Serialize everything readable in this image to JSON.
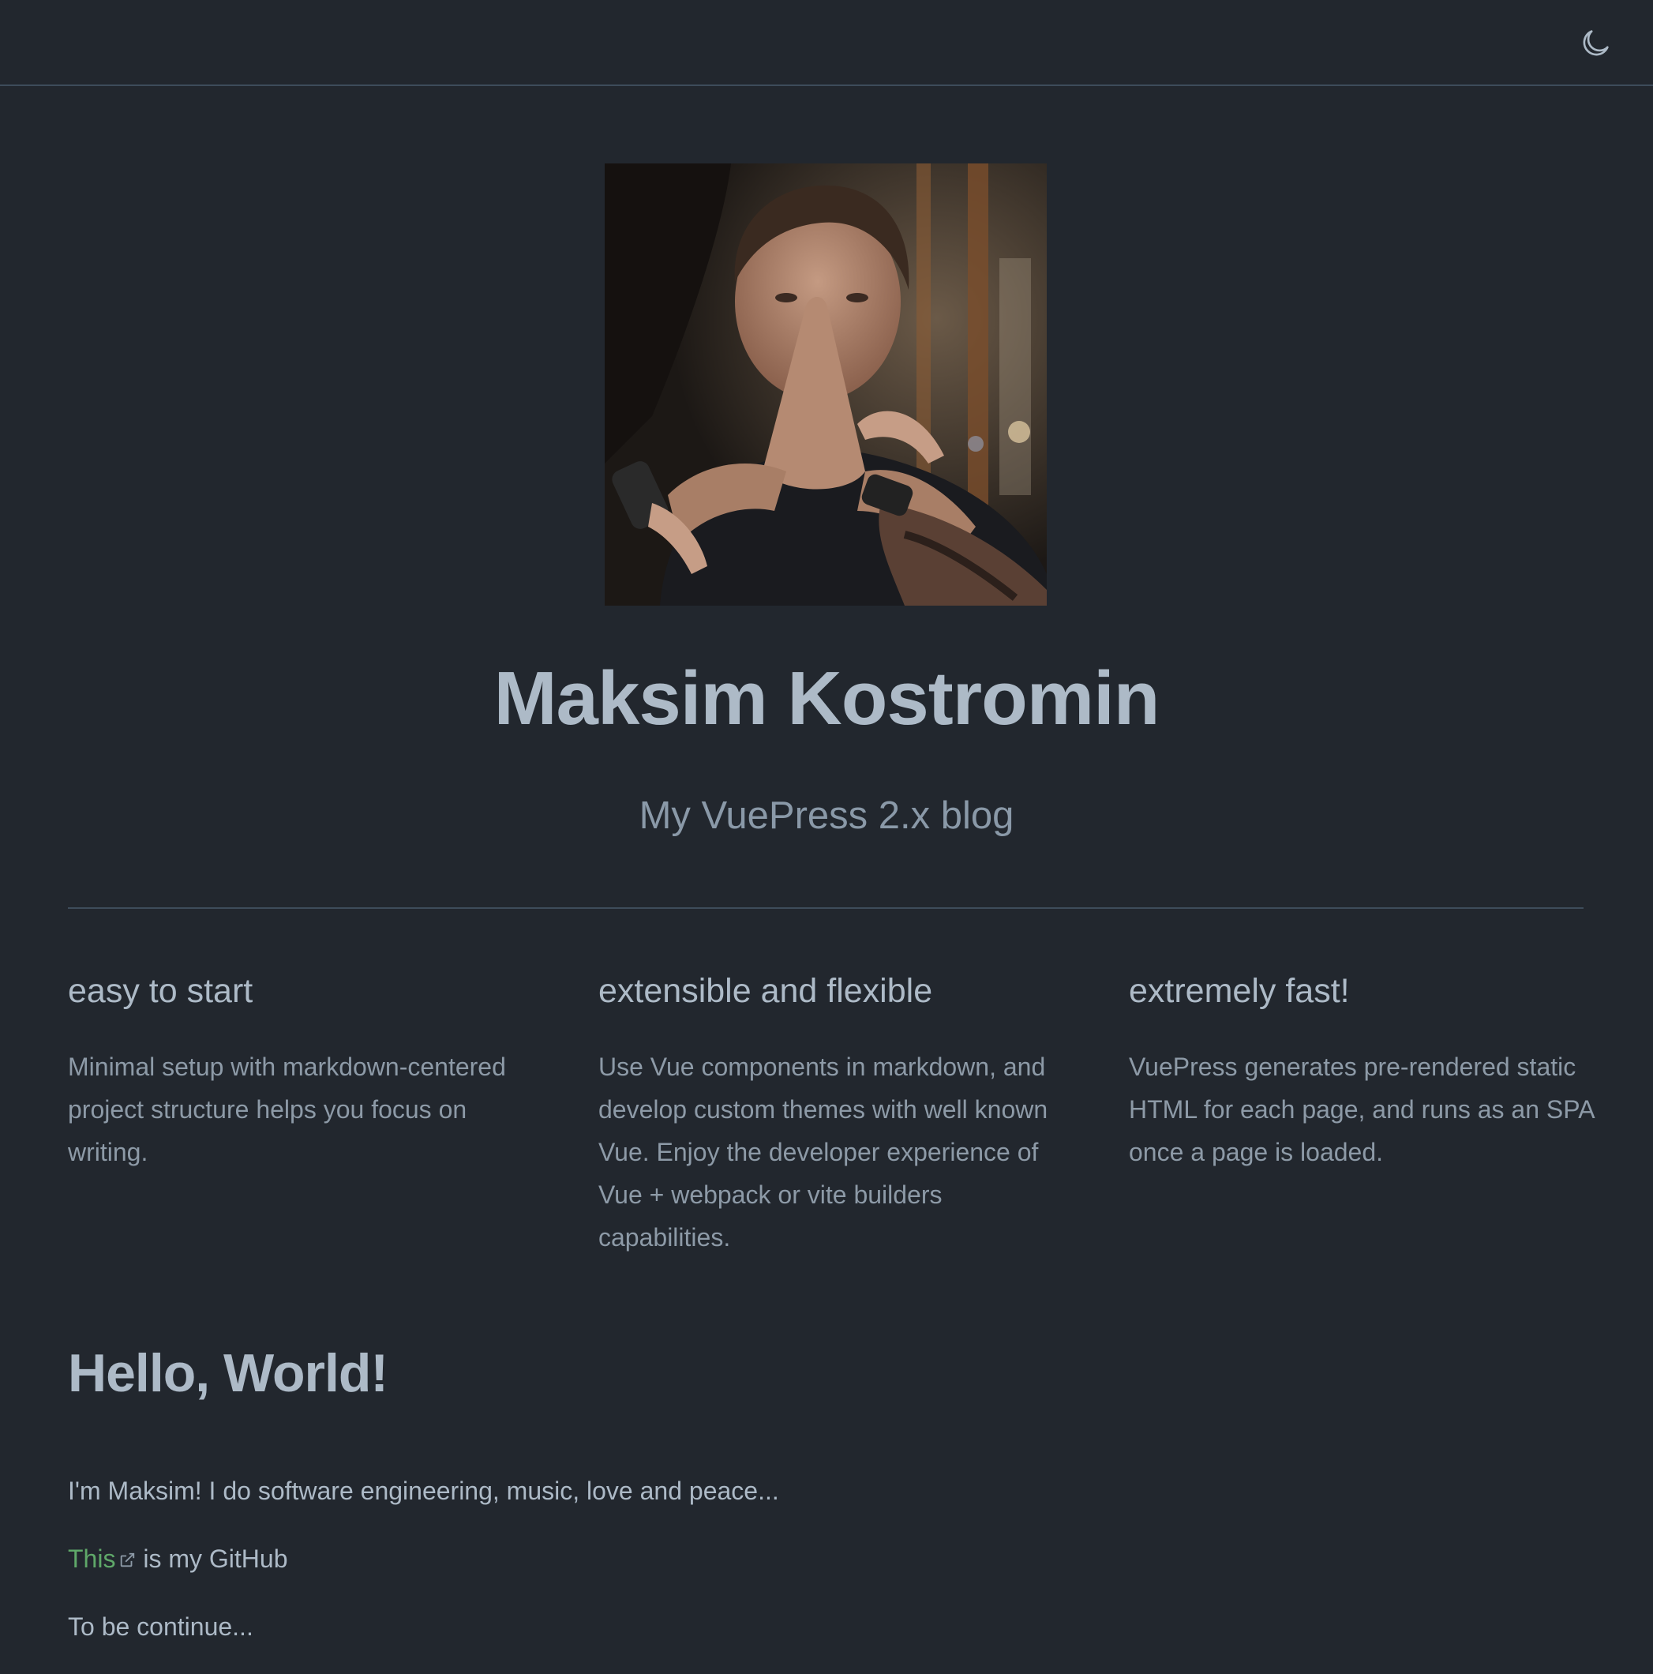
{
  "navbar": {
    "theme_toggle_icon": "moon-icon"
  },
  "hero": {
    "image_alt": "Portrait photo of Maksim Kostromin",
    "title": "Maksim Kostromin",
    "tagline": "My VuePress 2.x blog"
  },
  "features": [
    {
      "title": "easy to start",
      "details": "Minimal setup with markdown-centered project structure helps you focus on writing."
    },
    {
      "title": "extensible and flexible",
      "details": "Use Vue components in markdown, and develop custom themes with well known Vue. Enjoy the developer experience of Vue + webpack or vite builders capabilities."
    },
    {
      "title": "extremely fast!",
      "details": "VuePress generates pre-rendered static HTML for each page, and runs as an SPA once a page is loaded."
    }
  ],
  "content": {
    "heading": "Hello, World!",
    "intro": "I'm Maksim! I do software engineering, music, love and peace...",
    "github_link_text": "This",
    "github_suffix": " is my GitHub",
    "outro": "To be continue..."
  },
  "colors": {
    "background": "#22272e",
    "text": "#adbac7",
    "muted_text": "#8d9aa7",
    "link": "#5fa869",
    "divider": "#3e4c5a"
  }
}
